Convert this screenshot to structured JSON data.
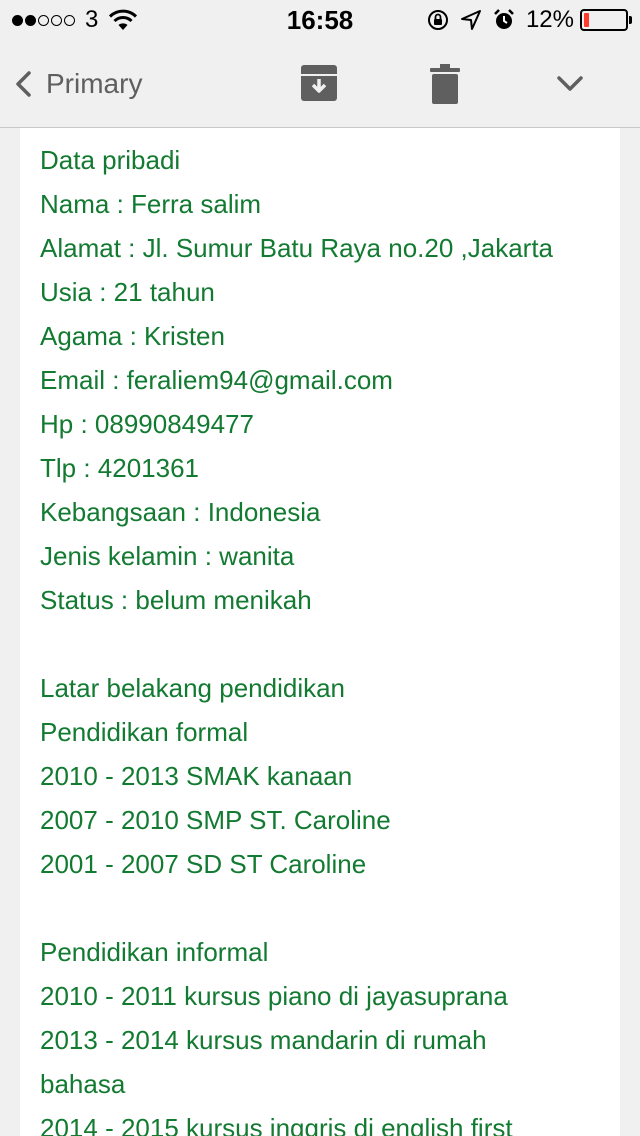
{
  "status_bar": {
    "signal_dots": [
      true,
      true,
      false,
      false,
      false
    ],
    "carrier": "3",
    "time": "16:58",
    "battery_percent": "12%",
    "battery_level": 0.12,
    "battery_color": "#ff3b30"
  },
  "toolbar": {
    "back_label": "Primary",
    "icons": [
      "archive-icon",
      "trash-icon",
      "chevron-down-icon"
    ]
  },
  "colors": {
    "text_green": "#137a32",
    "toolbar_gray": "#5f5f5f"
  },
  "email_lines": [
    "Data pribadi",
    "Nama : Ferra salim",
    "Alamat : Jl. Sumur Batu Raya no.20 ,Jakarta",
    "Usia : 21 tahun",
    "Agama : Kristen",
    "Email : feraliem94@gmail.com",
    "Hp : 08990849477",
    "Tlp : 4201361",
    "Kebangsaan : Indonesia",
    "Jenis kelamin : wanita",
    "Status : belum menikah",
    "",
    "Latar belakang pendidikan",
    "Pendidikan formal",
    "2010 - 2013 SMAK kanaan",
    "2007 - 2010 SMP ST. Caroline",
    "2001 - 2007 SD ST Caroline",
    "",
    "Pendidikan informal",
    "2010 - 2011 kursus piano di jayasuprana",
    "2013 - 2014 kursus mandarin di rumah",
    "bahasa",
    "2014 - 2015 kursus inggris di english first"
  ]
}
